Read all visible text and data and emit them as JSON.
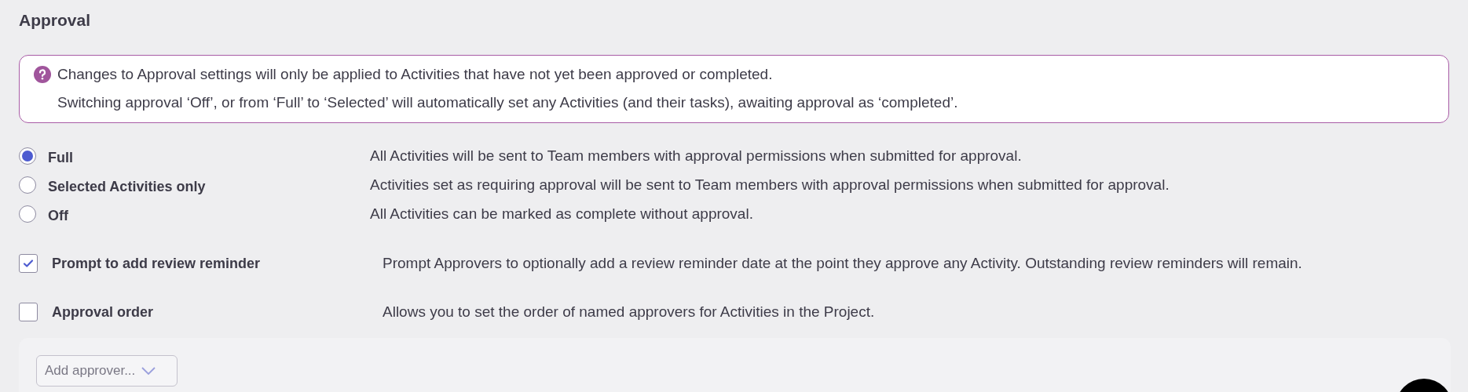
{
  "title": "Approval",
  "notice": {
    "lines": [
      "Changes to Approval settings will only be applied to Activities that have not yet been approved or completed.",
      "Switching approval ‘Off’, or from ‘Full’ to ‘Selected’ will automatically set any Activities (and their tasks), awaiting approval as ‘completed’."
    ]
  },
  "approval_modes": [
    {
      "label": "Full",
      "description": "All Activities will be sent to Team members with approval permissions when submitted for approval.",
      "selected": true
    },
    {
      "label": "Selected Activities only",
      "description": "Activities set as requiring approval will be sent to Team members with approval permissions when submitted for approval.",
      "selected": false
    },
    {
      "label": "Off",
      "description": "All Activities can be marked as complete without approval.",
      "selected": false
    }
  ],
  "options": [
    {
      "label": "Prompt to add review reminder",
      "description": "Prompt Approvers to optionally add a review reminder date at the point they approve any Activity. Outstanding review reminders will remain.",
      "checked": true
    },
    {
      "label": "Approval order",
      "description": "Allows you to set the order of named approvers for Activities in the Project.",
      "checked": false
    }
  ],
  "approver_select": {
    "placeholder": "Add approver..."
  }
}
